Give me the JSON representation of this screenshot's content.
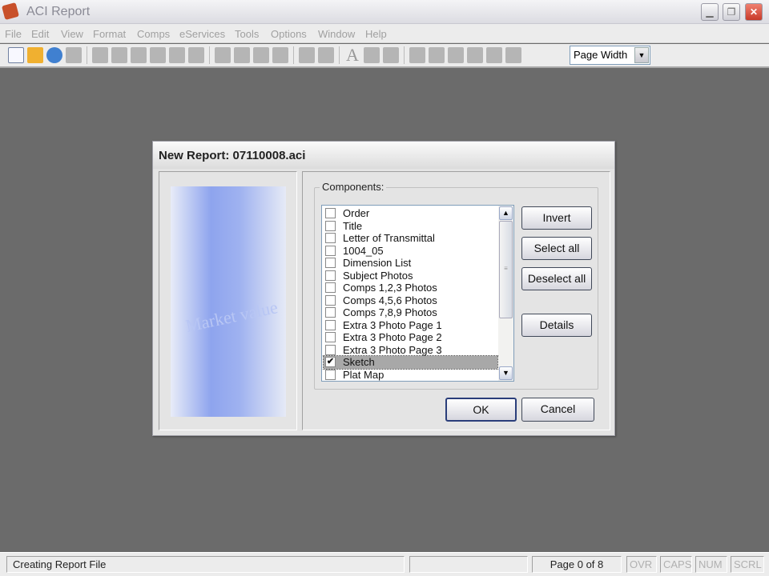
{
  "app": {
    "title": "ACI Report",
    "window_buttons": [
      "minimize",
      "restore",
      "close"
    ]
  },
  "menu": [
    "File",
    "Edit",
    "View",
    "Format",
    "Comps",
    "eServices",
    "Tools",
    "Options",
    "Window",
    "Help"
  ],
  "toolbar": {
    "icons": [
      "new-icon",
      "open-icon",
      "preview-icon",
      "save-icon",
      "|",
      "icon",
      "icon",
      "icon",
      "search-icon",
      "icon",
      "pen-icon",
      "|",
      "cut-icon",
      "copy-icon",
      "paste-icon",
      "undo-icon",
      "|",
      "icon",
      "icon",
      "|",
      "text-icon",
      "icon",
      "icon",
      "|",
      "icon",
      "icon",
      "icon",
      "icon",
      "icon",
      "icon"
    ],
    "text_glyph": "A",
    "zoom_value": "Page Width"
  },
  "dialog": {
    "title": "New Report: 07110008.aci",
    "art_text": "Market value",
    "group_label": "Components:",
    "components": [
      {
        "label": "Order",
        "checked": false
      },
      {
        "label": "Title",
        "checked": false
      },
      {
        "label": "Letter of Transmittal",
        "checked": false
      },
      {
        "label": "1004_05",
        "checked": false
      },
      {
        "label": "Dimension List",
        "checked": false
      },
      {
        "label": "Subject Photos",
        "checked": false
      },
      {
        "label": "Comps 1,2,3 Photos",
        "checked": false
      },
      {
        "label": "Comps 4,5,6 Photos",
        "checked": false
      },
      {
        "label": "Comps 7,8,9 Photos",
        "checked": false
      },
      {
        "label": "Extra 3 Photo Page 1",
        "checked": false
      },
      {
        "label": "Extra 3 Photo Page 2",
        "checked": false
      },
      {
        "label": "Extra 3 Photo Page 3",
        "checked": false
      },
      {
        "label": "Sketch",
        "checked": true,
        "selected": true
      },
      {
        "label": "Plat Map",
        "checked": false
      }
    ],
    "buttons": {
      "invert": "Invert",
      "select_all": "Select all",
      "deselect_all": "Deselect all",
      "details": "Details",
      "ok": "OK",
      "cancel": "Cancel"
    }
  },
  "status": {
    "message": "Creating Report File",
    "page": "Page 0 of 8",
    "indicators": [
      "OVR",
      "CAPS",
      "NUM",
      "SCRL"
    ]
  }
}
